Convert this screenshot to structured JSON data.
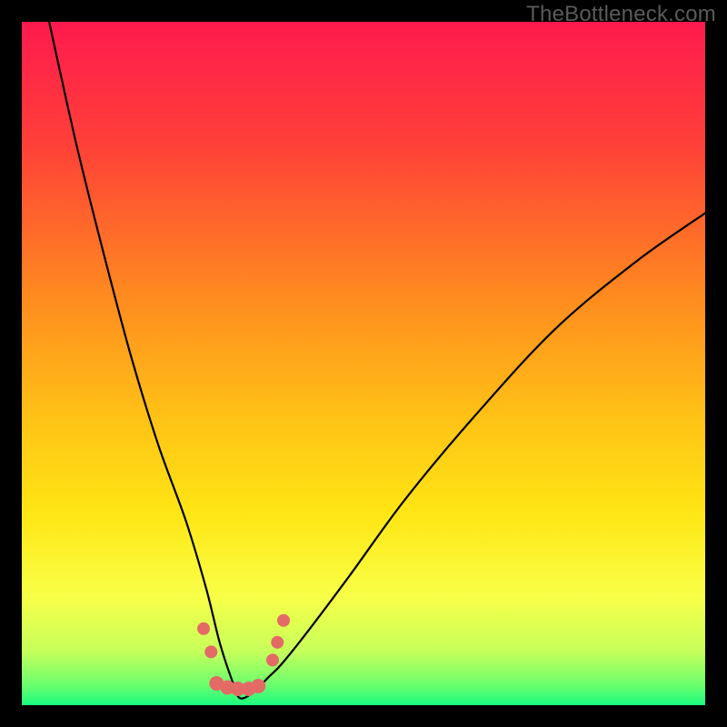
{
  "watermark": "TheBottleneck.com",
  "chart_data": {
    "type": "line",
    "title": "",
    "xlabel": "",
    "ylabel": "",
    "xlim": [
      0,
      100
    ],
    "ylim": [
      0,
      100
    ],
    "background_gradient": {
      "top_color": "#ff1a4e",
      "mid_upper_color": "#ff8a1f",
      "mid_color": "#ffe614",
      "mid_lower_color": "#f8ff47",
      "bottom_color": "#1bfb7f"
    },
    "series": [
      {
        "name": "bottleneck-curve",
        "description": "V-shaped black curve: steep descent from top-left to a minimum near x≈32, then rising concave toward the right edge around y≈30.",
        "x": [
          4,
          8,
          12,
          16,
          20,
          24,
          27,
          29,
          31,
          32,
          34,
          36,
          38,
          42,
          48,
          56,
          66,
          78,
          90,
          100
        ],
        "y": [
          100,
          82,
          66,
          51,
          38,
          27,
          17,
          9,
          3,
          1,
          2,
          4,
          6,
          11,
          19,
          30,
          42,
          55,
          65,
          72
        ]
      }
    ],
    "markers": {
      "name": "near-minimum-markers",
      "color": "#e46a66",
      "points": [
        {
          "x": 26.6,
          "y": 11.2,
          "r": 7
        },
        {
          "x": 27.7,
          "y": 7.8,
          "r": 7
        },
        {
          "x": 28.5,
          "y": 3.2,
          "r": 8
        },
        {
          "x": 30.1,
          "y": 2.6,
          "r": 8
        },
        {
          "x": 31.6,
          "y": 2.4,
          "r": 8
        },
        {
          "x": 33.2,
          "y": 2.4,
          "r": 8
        },
        {
          "x": 34.6,
          "y": 2.8,
          "r": 8
        },
        {
          "x": 36.7,
          "y": 6.6,
          "r": 7
        },
        {
          "x": 37.4,
          "y": 9.2,
          "r": 7
        },
        {
          "x": 38.3,
          "y": 12.4,
          "r": 7
        }
      ]
    }
  }
}
